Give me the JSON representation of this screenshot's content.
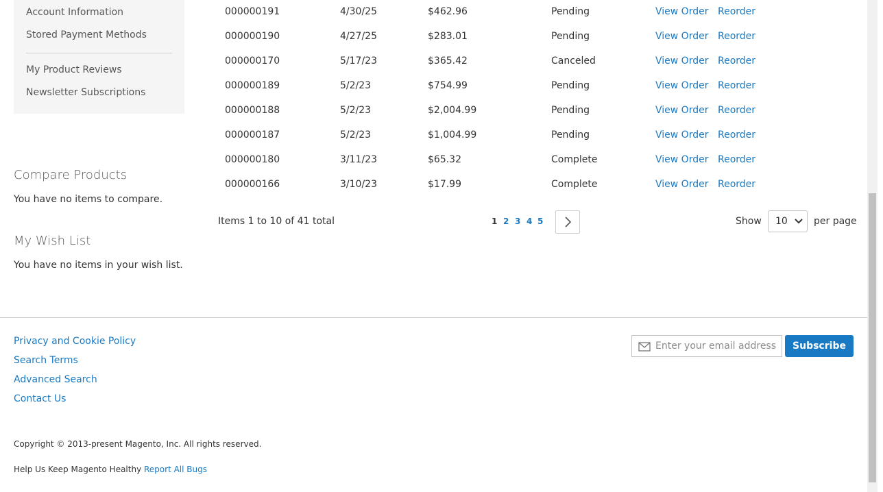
{
  "sidebar": {
    "items": [
      {
        "label": "Account Information"
      },
      {
        "label": "Stored Payment Methods"
      },
      {
        "label": "My Product Reviews"
      },
      {
        "label": "Newsletter Subscriptions"
      }
    ]
  },
  "compare": {
    "title": "Compare Products",
    "empty_text": "You have no items to compare."
  },
  "wishlist": {
    "title": "My Wish List",
    "empty_text": "You have no items in your wish list."
  },
  "orders": {
    "rows": [
      {
        "number": "000000191",
        "date": "4/30/25",
        "total": "$462.96",
        "status": "Pending",
        "view": "View Order",
        "reorder": "Reorder"
      },
      {
        "number": "000000190",
        "date": "4/27/25",
        "total": "$283.01",
        "status": "Pending",
        "view": "View Order",
        "reorder": "Reorder"
      },
      {
        "number": "000000170",
        "date": "5/17/23",
        "total": "$365.42",
        "status": "Canceled",
        "view": "View Order",
        "reorder": "Reorder"
      },
      {
        "number": "000000189",
        "date": "5/2/23",
        "total": "$754.99",
        "status": "Pending",
        "view": "View Order",
        "reorder": "Reorder"
      },
      {
        "number": "000000188",
        "date": "5/2/23",
        "total": "$2,004.99",
        "status": "Pending",
        "view": "View Order",
        "reorder": "Reorder"
      },
      {
        "number": "000000187",
        "date": "5/2/23",
        "total": "$1,004.99",
        "status": "Pending",
        "view": "View Order",
        "reorder": "Reorder"
      },
      {
        "number": "000000180",
        "date": "3/11/23",
        "total": "$65.32",
        "status": "Complete",
        "view": "View Order",
        "reorder": "Reorder"
      },
      {
        "number": "000000166",
        "date": "3/10/23",
        "total": "$17.99",
        "status": "Complete",
        "view": "View Order",
        "reorder": "Reorder"
      }
    ]
  },
  "toolbar": {
    "items_count": "Items 1 to 10 of 41 total",
    "pages": [
      "1",
      "2",
      "3",
      "4",
      "5"
    ],
    "current_page": "1",
    "show_label": "Show",
    "limiter_value": "10",
    "per_page_label": "per page"
  },
  "footer": {
    "links": [
      "Privacy and Cookie Policy",
      "Search Terms",
      "Advanced Search",
      "Contact Us"
    ],
    "newsletter_placeholder": "Enter your email address",
    "subscribe_label": "Subscribe",
    "copyright": "Copyright © 2013-present Magento, Inc. All rights reserved.",
    "bugs_text": "Help Us Keep Magento Healthy",
    "bugs_link": "Report All Bugs"
  },
  "colors": {
    "link": "#1979c3",
    "sidebar_bg": "#f5f5f5",
    "button": "#1979c3"
  }
}
